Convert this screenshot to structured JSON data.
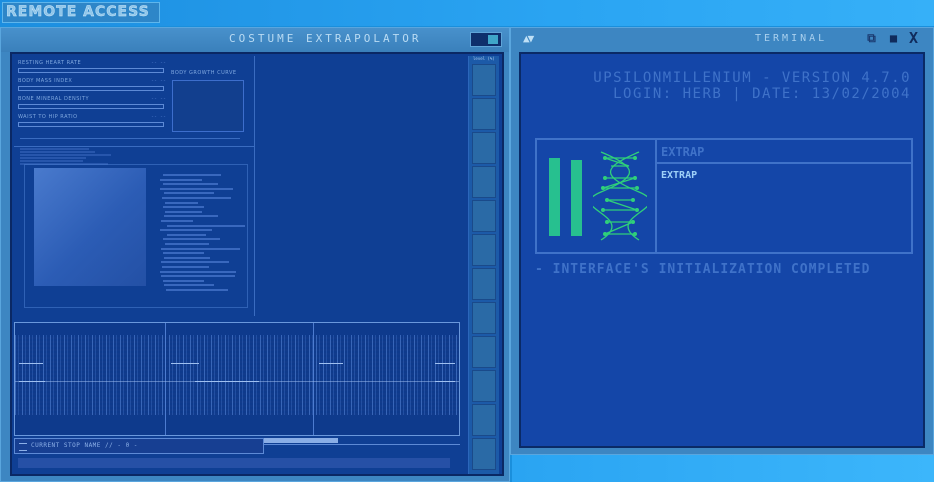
{
  "app": {
    "remote_access_label": "REMOTE ACCESS"
  },
  "costume_window": {
    "title": "COSTUME EXTRAPOLATOR",
    "stats": [
      {
        "label": "RESTING HEART RATE",
        "value": "-- --"
      },
      {
        "label": "BODY MASS INDEX",
        "value": "-- --"
      },
      {
        "label": "BONE MINERAL DENSITY",
        "value": "-- --"
      },
      {
        "label": "WAIST TO HIP RATIO",
        "value": "-- --"
      }
    ],
    "growth_curve_label": "BODY GROWTH CURVE",
    "side_column_label": "level (%)",
    "current_stop_label": "CURRENT STOP NAME // - 0 -",
    "stop_progress": 0.38
  },
  "terminal": {
    "title": "TERMINAL",
    "buttons": {
      "restore": "⧉",
      "maximize": "■",
      "close": "X"
    },
    "arrows": "▲▼",
    "version_line": "UPSILONMILLENIUM - VERSION 4.7.0",
    "login_line": "LOGIN: HERB | DATE: 13/02/2004",
    "module_header": "EXTRAP",
    "module_items": [
      "EXTRAP"
    ],
    "status_message": "- INTERFACE'S INITIALIZATION COMPLETED"
  },
  "colors": {
    "background": "#1a8fdc",
    "panel": "#0f3f94",
    "terminal_text": "#3f72c9",
    "accent_green": "#27c08f"
  }
}
